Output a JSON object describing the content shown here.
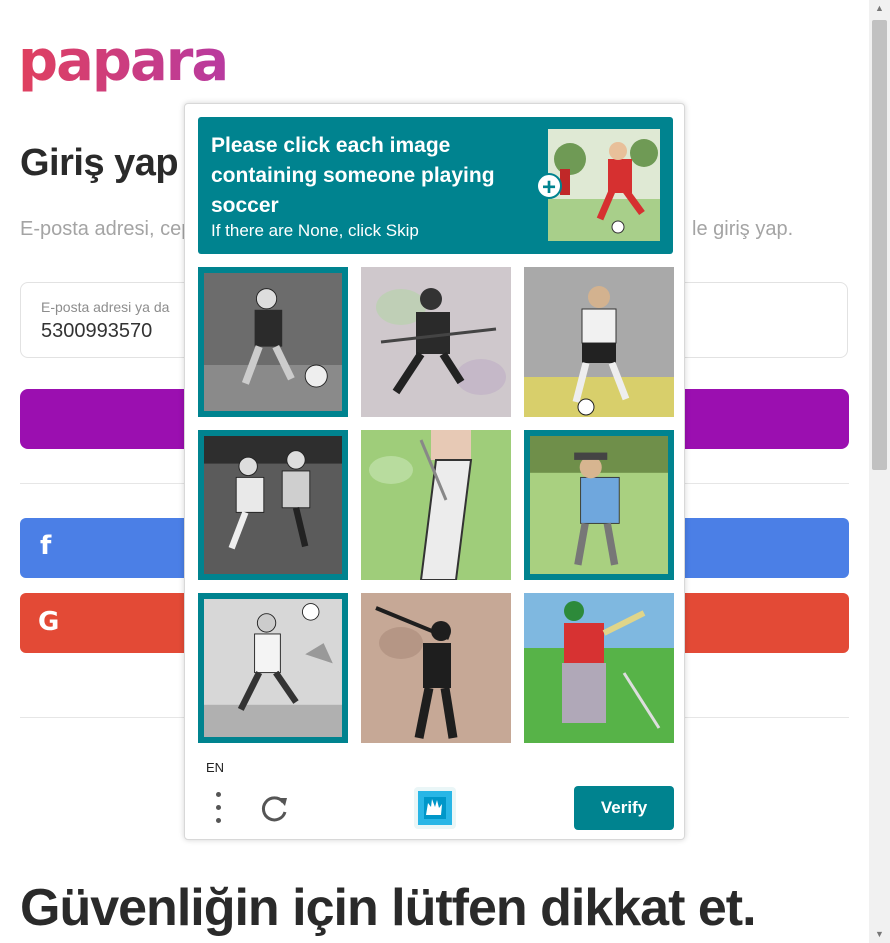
{
  "page": {
    "logo": "papara",
    "title": "Giriş yap",
    "subtitle_visible_start": "E-posta adresi, cep",
    "subtitle_visible_end": "le giriş yap.",
    "input_label": "E-posta adresi ya da",
    "input_value": "5300993570",
    "footer_heading": "Güvenliğin için lütfen dikkat et."
  },
  "social": {
    "facebook_icon": "f",
    "google_icon": "G"
  },
  "captcha": {
    "prompt": "Please click each image containing someone playing soccer",
    "instruction": "If there are None, click Skip",
    "plus_icon": "+",
    "language": "EN",
    "verify_label": "Verify",
    "tiles": [
      {
        "subject": "soccer-player-kicking",
        "selected": true
      },
      {
        "subject": "hockey-player",
        "selected": false
      },
      {
        "subject": "soccer-player-field",
        "selected": false
      },
      {
        "subject": "two-soccer-players",
        "selected": true
      },
      {
        "subject": "golfer-legs",
        "selected": false
      },
      {
        "subject": "golfer-putting",
        "selected": true
      },
      {
        "subject": "soccer-player-running",
        "selected": true
      },
      {
        "subject": "golfer-swing-silhouette",
        "selected": false
      },
      {
        "subject": "golfer-red-shirt",
        "selected": false
      }
    ]
  },
  "colors": {
    "accent": "#00838f",
    "brand": "#d63a78",
    "continue": "#9b0fb0",
    "facebook": "#4b7fe6",
    "google": "#e34a36"
  }
}
